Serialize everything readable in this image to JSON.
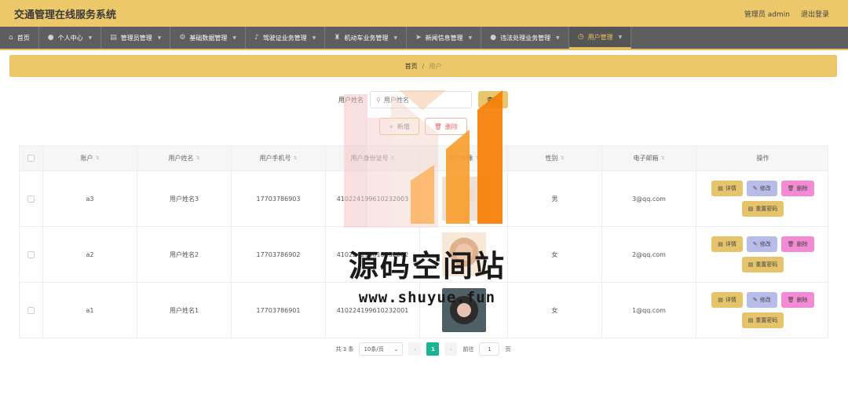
{
  "header": {
    "title": "交通管理在线服务系统",
    "admin": "管理员 admin",
    "logout": "退出登录"
  },
  "nav": [
    {
      "label": "首页",
      "icon": "home-icon"
    },
    {
      "label": "个人中心",
      "icon": "user-icon"
    },
    {
      "label": "管理员管理",
      "icon": "document-icon"
    },
    {
      "label": "基础数据管理",
      "icon": "gear-icon"
    },
    {
      "label": "驾驶证业务管理",
      "icon": "mic-icon"
    },
    {
      "label": "机动车业务管理",
      "icon": "trophy-icon"
    },
    {
      "label": "新闻信息管理",
      "icon": "send-icon"
    },
    {
      "label": "违法处理业务管理",
      "icon": "user-icon"
    },
    {
      "label": "用户管理",
      "icon": "clock-icon"
    }
  ],
  "breadcrumb": {
    "home": "首页",
    "sep": "/",
    "current": "用户"
  },
  "search": {
    "label": "用户姓名",
    "placeholder": "用户姓名",
    "button": "查询"
  },
  "actions": {
    "add": "新增",
    "delete": "删除"
  },
  "table": {
    "headers": [
      "账户",
      "用户姓名",
      "用户手机号",
      "用户身份证号",
      "用户头像",
      "性别",
      "电子邮箱",
      "操作"
    ],
    "rows": [
      {
        "account": "a3",
        "name": "用户姓名3",
        "phone": "17703786903",
        "idcard": "410224199610232003",
        "gender": "男",
        "email": "3@qq.com"
      },
      {
        "account": "a2",
        "name": "用户姓名2",
        "phone": "17703786902",
        "idcard": "410224199610232002",
        "gender": "女",
        "email": "2@qq.com"
      },
      {
        "account": "a1",
        "name": "用户姓名1",
        "phone": "17703786901",
        "idcard": "410224199610232001",
        "gender": "女",
        "email": "1@qq.com"
      }
    ],
    "ops": {
      "detail": "详情",
      "edit": "修改",
      "delete": "删除",
      "reset": "重置密码"
    }
  },
  "pagination": {
    "total": "共 3 条",
    "page_size": "10条/页",
    "current": "1",
    "goto_label": "前往",
    "goto_value": "1",
    "page_unit": "页"
  },
  "watermark": {
    "text": "源码空间站",
    "url": "www.shuyue.fun"
  },
  "colors": {
    "accent": "#ecc86a",
    "nav_bg": "#5e5e5e",
    "pager_active": "#1ab394"
  }
}
